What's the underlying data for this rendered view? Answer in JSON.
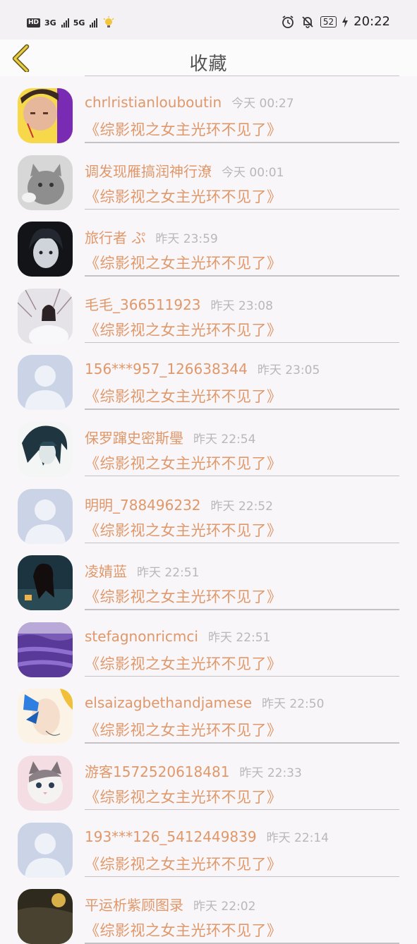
{
  "status_bar": {
    "left": [
      "HD",
      "3G",
      "5G"
    ],
    "battery": "52",
    "time": "20:22"
  },
  "header": {
    "title": "收藏"
  },
  "accent_color": "#e0986a",
  "items": [
    {
      "user": "chrlristianlouboutin",
      "time": "今天 00:27",
      "work": "《综影视之女主光环不见了》",
      "avatar": "photo-man"
    },
    {
      "user": "调发现雁搞润神行潦",
      "time": "今天 00:01",
      "work": "《综影视之女主光环不见了》",
      "avatar": "photo-cat-gray"
    },
    {
      "user": "旅行者 ぷ",
      "time": "昨天 23:59",
      "work": "《综影视之女主光环不见了》",
      "avatar": "photo-dark-anime"
    },
    {
      "user": "毛毛_366511923",
      "time": "昨天 23:08",
      "work": "《综影视之女主光环不见了》",
      "avatar": "photo-winter-girl"
    },
    {
      "user": "156***957_126638344",
      "time": "昨天 23:05",
      "work": "《综影视之女主光环不见了》",
      "avatar": "default-user"
    },
    {
      "user": "保罗蹿史密斯璺",
      "time": "昨天 22:54",
      "work": "《综影视之女主光环不见了》",
      "avatar": "photo-anime-boy"
    },
    {
      "user": "明明_788496232",
      "time": "昨天 22:52",
      "work": "《综影视之女主光环不见了》",
      "avatar": "default-user"
    },
    {
      "user": "凌婧蓝",
      "time": "昨天 22:51",
      "work": "《综影视之女主光环不见了》",
      "avatar": "photo-woman-night"
    },
    {
      "user": "stefagnonricmci",
      "time": "昨天 22:51",
      "work": "《综影视之女主光环不见了》",
      "avatar": "photo-lavender"
    },
    {
      "user": "elsaizagbethandjamese",
      "time": "昨天 22:50",
      "work": "《综影视之女主光环不见了》",
      "avatar": "photo-butterfly"
    },
    {
      "user": "游客1572520618481",
      "time": "昨天 22:33",
      "work": "《综影视之女主光环不见了》",
      "avatar": "photo-kitten"
    },
    {
      "user": "193***126_5412449839",
      "time": "昨天 22:14",
      "work": "《综影视之女主光环不见了》",
      "avatar": "default-user"
    },
    {
      "user": "平运析紫顾图录",
      "time": "昨天 22:02",
      "work": "《综影视之女主光环不见了》",
      "avatar": "photo-partial"
    }
  ]
}
